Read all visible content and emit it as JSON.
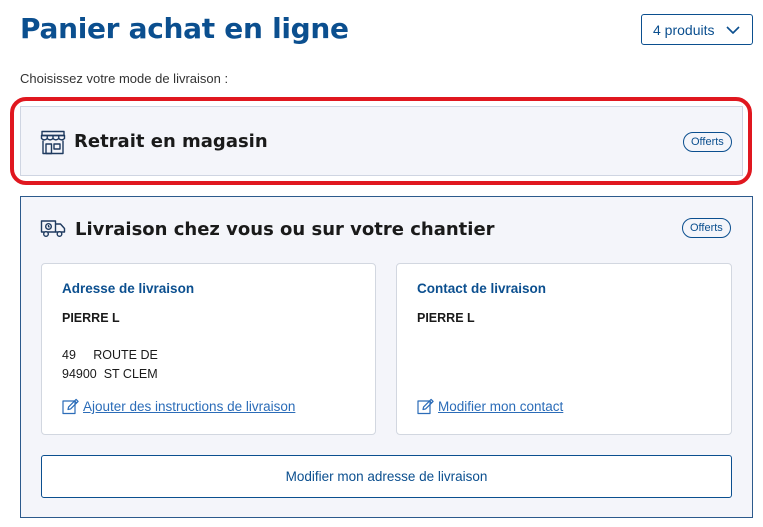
{
  "header": {
    "title": "Panier achat en ligne",
    "products_select": "4 produits"
  },
  "delivery_prompt": "Choisissez votre mode de livraison :",
  "pickup_option": {
    "title": "Retrait en magasin",
    "badge": "Offerts"
  },
  "delivery_option": {
    "title": "Livraison chez vous ou sur votre chantier",
    "badge": "Offerts",
    "address_card": {
      "title": "Adresse de livraison",
      "name": "PIERRE L",
      "line1": "49     ROUTE DE",
      "line2": "94900  ST CLEM",
      "link": "Ajouter des instructions de livraison"
    },
    "contact_card": {
      "title": "Contact de livraison",
      "name": "PIERRE L",
      "link": "Modifier mon contact"
    },
    "modify_button": "Modifier mon adresse de livraison"
  },
  "colors": {
    "brand_blue": "#0b4f8f",
    "link_blue": "#2b6cb8",
    "highlight_red": "#e0171f",
    "panel_bg": "#f4f5fa"
  },
  "icons": [
    "chevron-down-icon",
    "store-icon",
    "delivery-truck-icon",
    "edit-icon"
  ]
}
